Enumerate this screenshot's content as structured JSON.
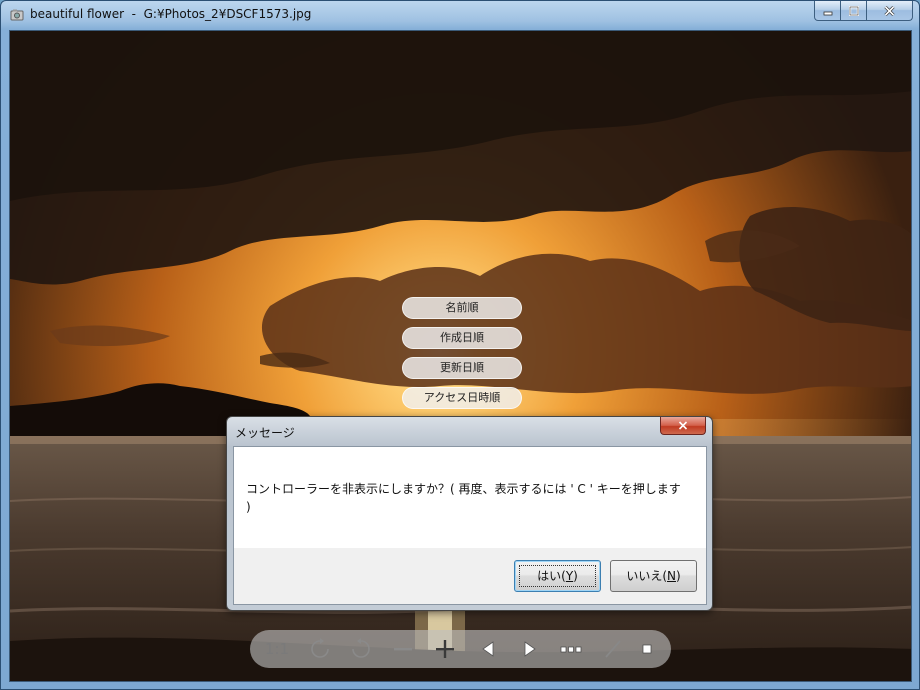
{
  "window": {
    "title": "beautiful flower  -  G:¥Photos_2¥DSCF1573.jpg",
    "icons": [
      "app-icon",
      "minimize-icon",
      "maximize-icon",
      "close-icon"
    ]
  },
  "sort_menu": {
    "items": [
      {
        "label": "名前順"
      },
      {
        "label": "作成日順"
      },
      {
        "label": "更新日順"
      },
      {
        "label": "アクセス日時順"
      }
    ]
  },
  "dialog": {
    "title": "メッセージ",
    "message": "コントローラーを非表示にしますか？( 再度、表示するには ' C ' キーを押します )",
    "yes_prefix": "はい(",
    "yes_key": "Y",
    "yes_suffix": ")",
    "no_prefix": "いいえ(",
    "no_key": "N",
    "no_suffix": ")"
  },
  "controller": {
    "zoom_label": "1:1",
    "icons": [
      "rotate-left-icon",
      "rotate-right-icon",
      "zoom-out-icon",
      "zoom-in-icon",
      "previous-icon",
      "next-icon",
      "more-icon",
      "edit-icon",
      "stop-icon"
    ]
  },
  "colors": {
    "frame": "#86b0d8",
    "sky_bright": "#f5a63a",
    "sky_dark": "#2a1a10",
    "dialog_close": "#c8432a"
  }
}
